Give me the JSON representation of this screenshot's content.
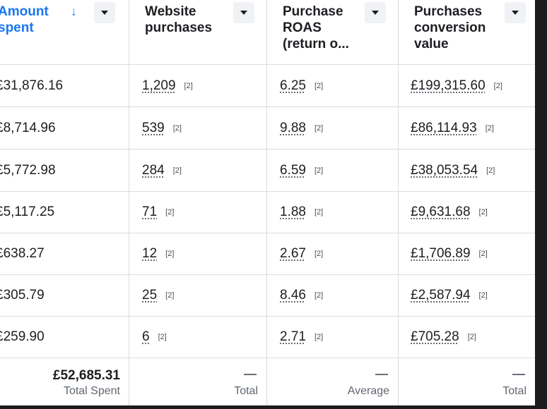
{
  "columns": [
    {
      "title": "Amount spent",
      "sorted": true
    },
    {
      "title": "Website purchases"
    },
    {
      "title": "Purchase ROAS (return o..."
    },
    {
      "title": "Purchases conversion value"
    }
  ],
  "sort_icon": "down-arrow",
  "rows": [
    {
      "amount": "£31,876.16",
      "purchases": "1,209",
      "roas": "6.25",
      "value": "£199,315.60"
    },
    {
      "amount": "£8,714.96",
      "purchases": "539",
      "roas": "9.88",
      "value": "£86,114.93"
    },
    {
      "amount": "£5,772.98",
      "purchases": "284",
      "roas": "6.59",
      "value": "£38,053.54"
    },
    {
      "amount": "£5,117.25",
      "purchases": "71",
      "roas": "1.88",
      "value": "£9,631.68"
    },
    {
      "amount": "£638.27",
      "purchases": "12",
      "roas": "2.67",
      "value": "£1,706.89"
    },
    {
      "amount": "£305.79",
      "purchases": "25",
      "roas": "8.46",
      "value": "£2,587.94"
    },
    {
      "amount": "£259.90",
      "purchases": "6",
      "roas": "2.71",
      "value": "£705.28"
    }
  ],
  "note": "[2]",
  "footer": {
    "total_spent_value": "£52,685.31",
    "total_spent_label": "Total Spent",
    "dash": "—",
    "purchases_label": "Total",
    "roas_label": "Average",
    "value_label": "Total"
  }
}
